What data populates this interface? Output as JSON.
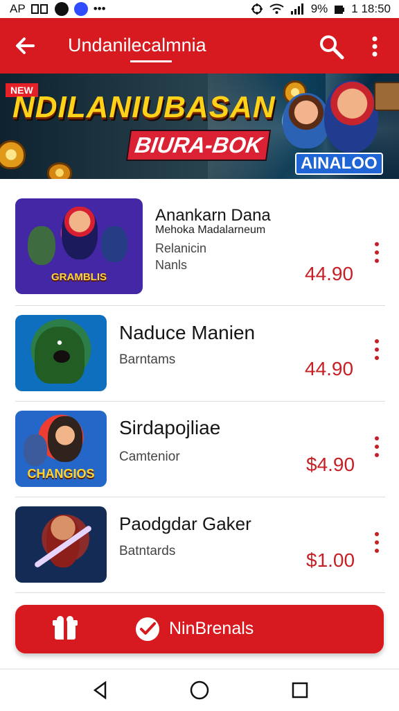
{
  "status": {
    "left_text": "AP",
    "right_text": "1 18:50",
    "battery": "9%"
  },
  "header": {
    "title": "Undanilecalmnia",
    "accent": "#d71920"
  },
  "banner": {
    "badge": "NEW",
    "title": "NDILANIUBASAN",
    "subtitle": "BIURA-BOK",
    "logo": "AINALOO"
  },
  "games": [
    {
      "title": "Anankarn Dana",
      "subtitle": "Mehoka Madalarneum",
      "desc_lines": [
        "Relanicin",
        "Nanls"
      ],
      "price": "44.90",
      "thumb_text": "GRAMBLIS"
    },
    {
      "title": "Naduce Manien",
      "desc": "Barntams",
      "price": "44.90",
      "thumb_text": ""
    },
    {
      "title": "Sirdapojliae",
      "desc": "Camtenior",
      "price": "$4.90",
      "thumb_text": "CHANGIOS"
    },
    {
      "title": "Paodgdar Gaker",
      "desc": "Batntards",
      "price": "$1.00",
      "thumb_text": ""
    }
  ],
  "action_button": {
    "label": "NinBrenals"
  }
}
